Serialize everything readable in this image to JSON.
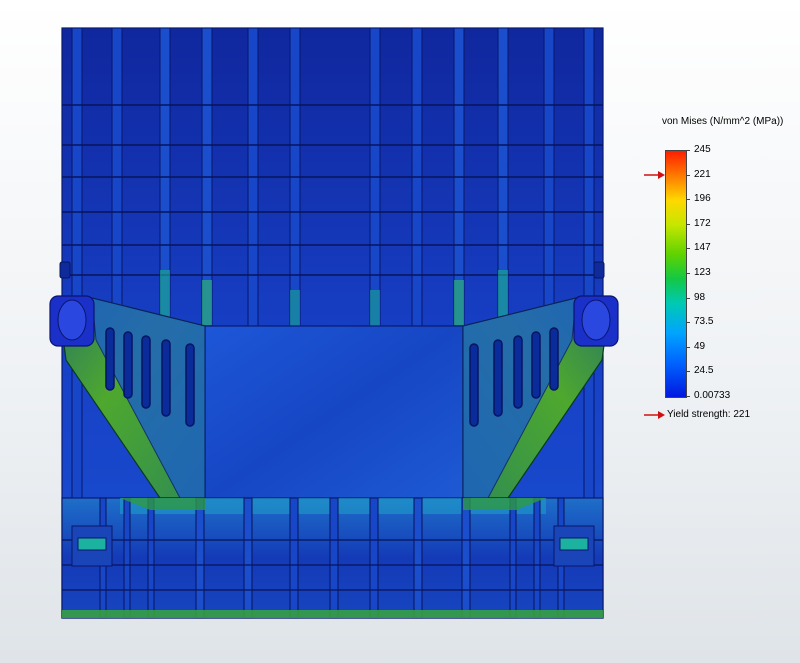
{
  "legend": {
    "title": "von Mises (N/mm^2 (MPa))",
    "ticks": [
      "245",
      "221",
      "196",
      "172",
      "147",
      "123",
      "98",
      "73.5",
      "49",
      "24.5",
      "0.00733"
    ],
    "yield_label": "Yield strength: 221",
    "yield_value": 221,
    "max_value": 245,
    "min_value": 0.00733
  },
  "colors": {
    "arrow": "#d01010",
    "frame": "#1438c8",
    "frame_dark": "#0a1f8c",
    "panel": "#1c48c8",
    "gusset": "#4aa52a",
    "background": "#f4f6f8"
  },
  "icons": {
    "yield_arrow": "right-arrow-icon",
    "max_arrow": "right-arrow-icon"
  }
}
